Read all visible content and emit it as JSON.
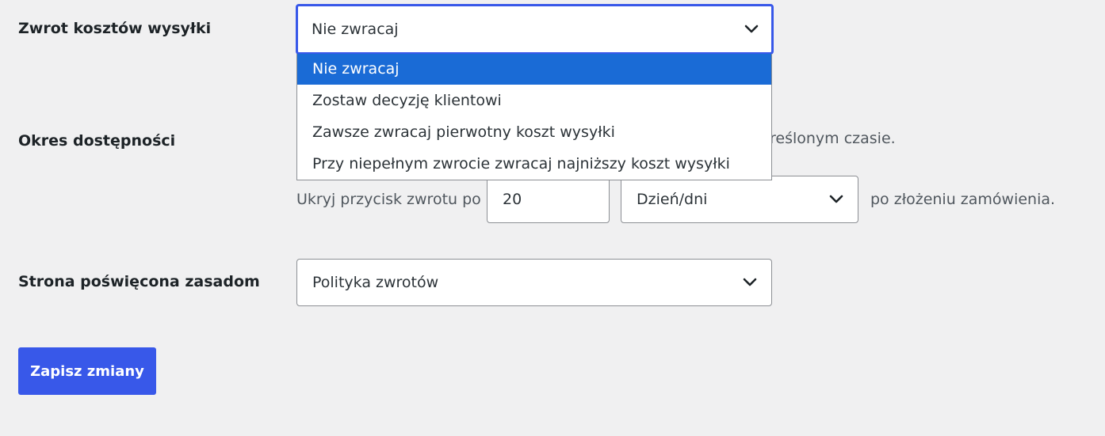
{
  "settings": {
    "shipping_refund": {
      "label": "Zwrot kosztów wysyłki",
      "selected": "Nie zwracaj",
      "options": [
        "Nie zwracaj",
        "Zostaw decyzję klientowi",
        "Zawsze zwracaj pierwotny koszt wysyłki",
        "Przy niepełnym zwrocie zwracaj najniższy koszt wysyłki"
      ]
    },
    "availability": {
      "label": "Okres dostępności",
      "description_fragment": "kreślonym czasie.",
      "prefix": "Ukryj przycisk zwrotu po",
      "value": "20",
      "unit": "Dzień/dni",
      "suffix": "po złożeniu zamówienia."
    },
    "policy_page": {
      "label": "Strona poświęcona zasadom",
      "selected": "Polityka zwrotów"
    }
  },
  "actions": {
    "save_label": "Zapisz zmiany"
  },
  "icons": {
    "select_arrow": "chevron-down-icon"
  },
  "colors": {
    "focus_border": "#3858e9",
    "option_highlight": "#1a6bd6",
    "primary_button": "#3858e9",
    "background": "#f0f0f1"
  }
}
